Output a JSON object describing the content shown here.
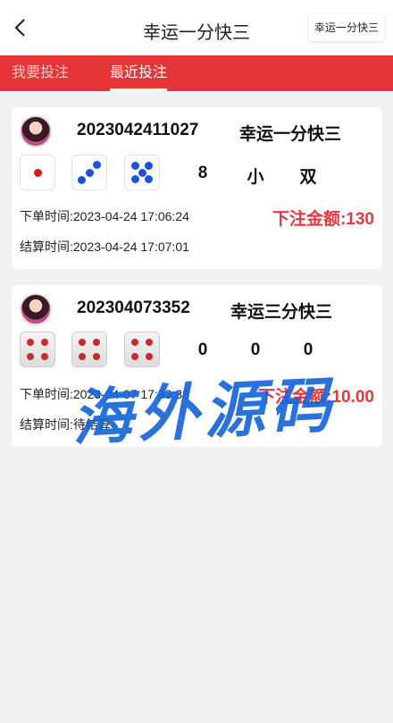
{
  "header": {
    "title": "幸运一分快三",
    "game_button": "幸运一分快三"
  },
  "tabs": [
    {
      "label": "我要投注"
    },
    {
      "label": "最近投注"
    }
  ],
  "bets": [
    {
      "order_no": "2023042411027",
      "game": "幸运一分快三",
      "dice": [
        1,
        3,
        5
      ],
      "results": [
        "8",
        "小",
        "双"
      ],
      "order_time_label": "下单时间:",
      "order_time": "2023-04-24 17:06:24",
      "settle_time_label": "结算时间:",
      "settle_time": "2023-04-24 17:07:01",
      "amount_label": "下注金额:",
      "amount": "130"
    },
    {
      "order_no": "202304073352",
      "game": "幸运三分快三",
      "dice": [
        4,
        4,
        4
      ],
      "results": [
        "0",
        "0",
        "0"
      ],
      "order_time_label": "下单时间:",
      "order_time": "2023-04-07 17:33:38",
      "settle_time_label": "结算时间:",
      "settle_time": "待结算",
      "amount_label": "下注金额:",
      "amount": "10.00"
    }
  ],
  "watermark": "海外源码",
  "colors": {
    "accent": "#e53537",
    "amount": "#e8353f",
    "pip_red": "#e0161b",
    "pip_blue": "#1b54d6",
    "pip_grey_red": "#c92a2e"
  }
}
